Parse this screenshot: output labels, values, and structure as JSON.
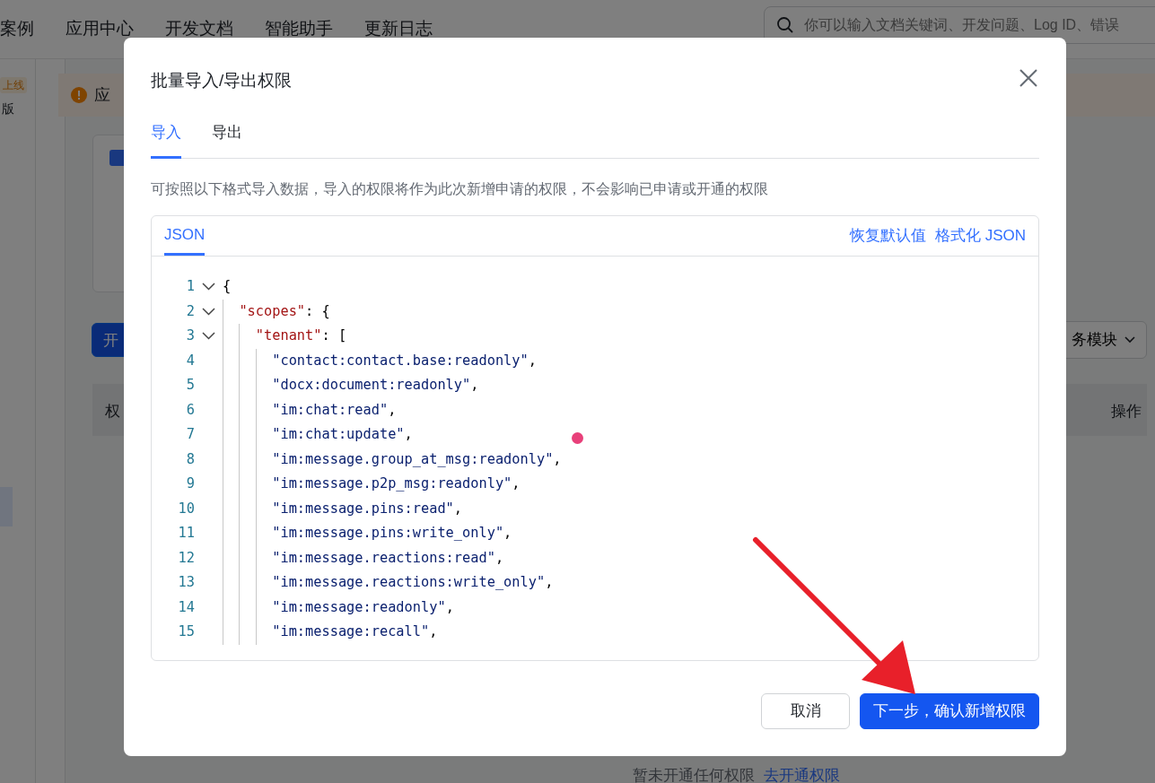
{
  "background": {
    "nav": [
      "案例",
      "应用中心",
      "开发文档",
      "智能助手",
      "更新日志"
    ],
    "search": {
      "placeholder": "你可以输入文档关键词、开发问题、Log ID、错误"
    },
    "status_tag": "上线",
    "version_label": "版",
    "alert_text": "应",
    "primary_button": "开",
    "module_dropdown": "务模块",
    "table_columns": [
      "权",
      "操作"
    ],
    "empty_text": "暂未开通任何权限",
    "empty_link": "去开通权限"
  },
  "dialog": {
    "title": "批量导入/导出权限",
    "tabs": [
      {
        "label": "导入",
        "selected": true
      },
      {
        "label": "导出",
        "selected": false
      }
    ],
    "description": "可按照以下格式导入数据，导入的权限将作为此次新增申请的权限，不会影响已申请或开通的权限",
    "editor": {
      "tabs": [
        {
          "label": "JSON",
          "selected": true
        }
      ],
      "actions": [
        "恢复默认值",
        "格式化 JSON"
      ],
      "lines": [
        {
          "number": "1",
          "foldable": true,
          "text": "{"
        },
        {
          "number": "2",
          "foldable": true,
          "text": "  \"scopes\": {"
        },
        {
          "number": "3",
          "foldable": true,
          "text": "    \"tenant\": ["
        },
        {
          "number": "4",
          "foldable": false,
          "text": "      \"contact:contact.base:readonly\","
        },
        {
          "number": "5",
          "foldable": false,
          "text": "      \"docx:document:readonly\","
        },
        {
          "number": "6",
          "foldable": false,
          "text": "      \"im:chat:read\","
        },
        {
          "number": "7",
          "foldable": false,
          "text": "      \"im:chat:update\","
        },
        {
          "number": "8",
          "foldable": false,
          "text": "      \"im:message.group_at_msg:readonly\","
        },
        {
          "number": "9",
          "foldable": false,
          "text": "      \"im:message.p2p_msg:readonly\","
        },
        {
          "number": "10",
          "foldable": false,
          "text": "      \"im:message.pins:read\","
        },
        {
          "number": "11",
          "foldable": false,
          "text": "      \"im:message.pins:write_only\","
        },
        {
          "number": "12",
          "foldable": false,
          "text": "      \"im:message.reactions:read\","
        },
        {
          "number": "13",
          "foldable": false,
          "text": "      \"im:message.reactions:write_only\","
        },
        {
          "number": "14",
          "foldable": false,
          "text": "      \"im:message:readonly\","
        },
        {
          "number": "15",
          "foldable": false,
          "text": "      \"im:message:recall\","
        }
      ]
    },
    "buttons": [
      {
        "label": "取消",
        "kind": "secondary"
      },
      {
        "label": "下一步，确认新增权限",
        "kind": "primary"
      }
    ]
  }
}
